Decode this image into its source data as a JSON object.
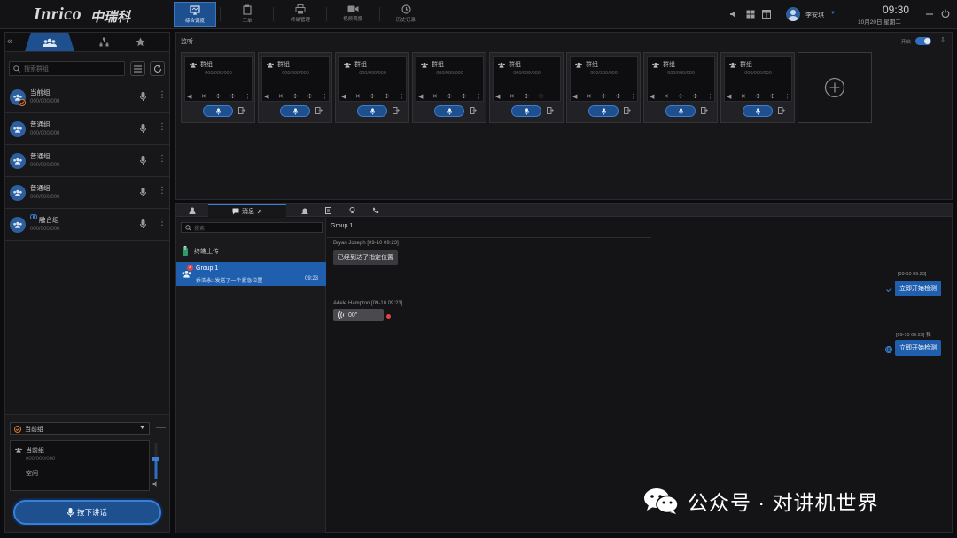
{
  "app": {
    "logo": "Inrico",
    "logo_cn": "中瑞科"
  },
  "nav": {
    "tabs": [
      {
        "label": "综合调度",
        "icon": "monitor-icon",
        "active": true
      },
      {
        "label": "工单",
        "icon": "clipboard-icon"
      },
      {
        "label": "终端管理",
        "icon": "printer-icon"
      },
      {
        "label": "视频调度",
        "icon": "video-camera-icon"
      },
      {
        "label": "历史记录",
        "icon": "history-icon"
      }
    ]
  },
  "header": {
    "user": "李安琪",
    "time": "09:30",
    "date": "10月20日 星期二"
  },
  "left": {
    "search_placeholder": "搜索群组",
    "groups": [
      {
        "name": "当前组",
        "num": "000/000/000"
      },
      {
        "name": "普通组",
        "num": "000/000/000"
      },
      {
        "name": "普通组",
        "num": "000/000/000"
      },
      {
        "name": "普通组",
        "num": "000/000/000"
      },
      {
        "name": "融合组",
        "num": "000/000/000"
      }
    ]
  },
  "ptt": {
    "select": "当前组",
    "name": "当前组",
    "num": "000/000/000",
    "status": "空闲",
    "button": "按下讲话"
  },
  "monitor": {
    "title": "监听",
    "toggle_label": "开启",
    "cards": [
      {
        "name": "群组",
        "num": "000/000/000"
      },
      {
        "name": "群组",
        "num": "000/000/000"
      },
      {
        "name": "群组",
        "num": "000/000/000"
      },
      {
        "name": "群组",
        "num": "000/000/000"
      },
      {
        "name": "群组",
        "num": "000/000/000"
      },
      {
        "name": "群组",
        "num": "000/100/000"
      },
      {
        "name": "群组",
        "num": "000/000/000"
      },
      {
        "name": "群组",
        "num": "000/000/000"
      }
    ]
  },
  "tabs": {
    "message": "消息"
  },
  "msglist": {
    "search_placeholder": "搜索",
    "upload": "终端上传",
    "group": {
      "name": "Group 1",
      "badge": "2",
      "snippet": "乔浩永: 发送了一个紧急位置",
      "time": "09:23"
    }
  },
  "chat": {
    "title": "Group 1",
    "messages": [
      {
        "side": "left",
        "sender": "Bryan Joseph",
        "time": "[09-10 09:23]",
        "text": "已经到达了指定位置"
      },
      {
        "side": "right",
        "time": "[09-10 09:23]",
        "text": "立即开始检测"
      },
      {
        "side": "left",
        "sender": "Adele Hampton",
        "time": "[09-10 09:23]",
        "voice": "00\""
      },
      {
        "side": "right",
        "time": "[09-10 09:23]",
        "sender_short": "我",
        "text": "立即开始检测"
      }
    ]
  },
  "watermark": {
    "text": "公众号 · 对讲机世界"
  }
}
